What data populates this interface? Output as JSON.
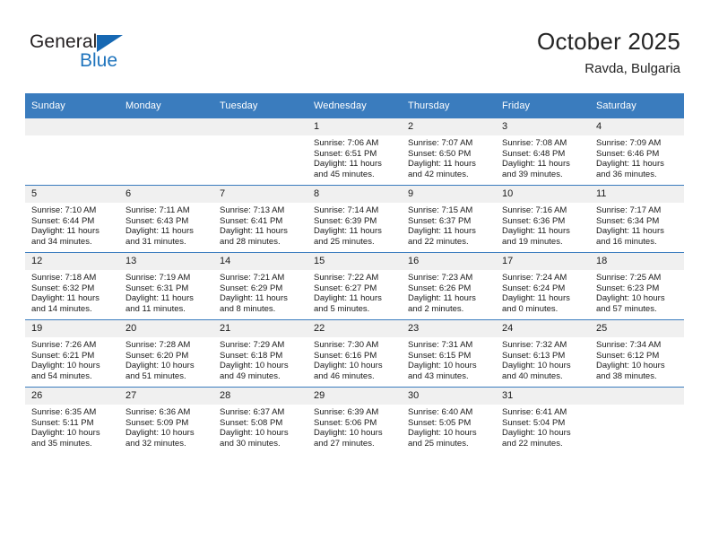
{
  "brand": {
    "name_part1": "General",
    "name_part2": "Blue",
    "logo_icon": "triangle-icon",
    "accent_color": "#1668b3"
  },
  "header": {
    "month_title": "October 2025",
    "location": "Ravda, Bulgaria",
    "header_bg_color": "#3a7cbe",
    "daynum_bg_color": "#f0f0f0"
  },
  "calendar": {
    "weekday_headers": [
      "Sunday",
      "Monday",
      "Tuesday",
      "Wednesday",
      "Thursday",
      "Friday",
      "Saturday"
    ],
    "weeks": [
      [
        {
          "day": "",
          "empty": true,
          "sunrise": "",
          "sunset": "",
          "daylight_line1": "",
          "daylight_line2": ""
        },
        {
          "day": "",
          "empty": true,
          "sunrise": "",
          "sunset": "",
          "daylight_line1": "",
          "daylight_line2": ""
        },
        {
          "day": "",
          "empty": true,
          "sunrise": "",
          "sunset": "",
          "daylight_line1": "",
          "daylight_line2": ""
        },
        {
          "day": "1",
          "empty": false,
          "sunrise": "Sunrise: 7:06 AM",
          "sunset": "Sunset: 6:51 PM",
          "daylight_line1": "Daylight: 11 hours",
          "daylight_line2": "and 45 minutes."
        },
        {
          "day": "2",
          "empty": false,
          "sunrise": "Sunrise: 7:07 AM",
          "sunset": "Sunset: 6:50 PM",
          "daylight_line1": "Daylight: 11 hours",
          "daylight_line2": "and 42 minutes."
        },
        {
          "day": "3",
          "empty": false,
          "sunrise": "Sunrise: 7:08 AM",
          "sunset": "Sunset: 6:48 PM",
          "daylight_line1": "Daylight: 11 hours",
          "daylight_line2": "and 39 minutes."
        },
        {
          "day": "4",
          "empty": false,
          "sunrise": "Sunrise: 7:09 AM",
          "sunset": "Sunset: 6:46 PM",
          "daylight_line1": "Daylight: 11 hours",
          "daylight_line2": "and 36 minutes."
        }
      ],
      [
        {
          "day": "5",
          "empty": false,
          "sunrise": "Sunrise: 7:10 AM",
          "sunset": "Sunset: 6:44 PM",
          "daylight_line1": "Daylight: 11 hours",
          "daylight_line2": "and 34 minutes."
        },
        {
          "day": "6",
          "empty": false,
          "sunrise": "Sunrise: 7:11 AM",
          "sunset": "Sunset: 6:43 PM",
          "daylight_line1": "Daylight: 11 hours",
          "daylight_line2": "and 31 minutes."
        },
        {
          "day": "7",
          "empty": false,
          "sunrise": "Sunrise: 7:13 AM",
          "sunset": "Sunset: 6:41 PM",
          "daylight_line1": "Daylight: 11 hours",
          "daylight_line2": "and 28 minutes."
        },
        {
          "day": "8",
          "empty": false,
          "sunrise": "Sunrise: 7:14 AM",
          "sunset": "Sunset: 6:39 PM",
          "daylight_line1": "Daylight: 11 hours",
          "daylight_line2": "and 25 minutes."
        },
        {
          "day": "9",
          "empty": false,
          "sunrise": "Sunrise: 7:15 AM",
          "sunset": "Sunset: 6:37 PM",
          "daylight_line1": "Daylight: 11 hours",
          "daylight_line2": "and 22 minutes."
        },
        {
          "day": "10",
          "empty": false,
          "sunrise": "Sunrise: 7:16 AM",
          "sunset": "Sunset: 6:36 PM",
          "daylight_line1": "Daylight: 11 hours",
          "daylight_line2": "and 19 minutes."
        },
        {
          "day": "11",
          "empty": false,
          "sunrise": "Sunrise: 7:17 AM",
          "sunset": "Sunset: 6:34 PM",
          "daylight_line1": "Daylight: 11 hours",
          "daylight_line2": "and 16 minutes."
        }
      ],
      [
        {
          "day": "12",
          "empty": false,
          "sunrise": "Sunrise: 7:18 AM",
          "sunset": "Sunset: 6:32 PM",
          "daylight_line1": "Daylight: 11 hours",
          "daylight_line2": "and 14 minutes."
        },
        {
          "day": "13",
          "empty": false,
          "sunrise": "Sunrise: 7:19 AM",
          "sunset": "Sunset: 6:31 PM",
          "daylight_line1": "Daylight: 11 hours",
          "daylight_line2": "and 11 minutes."
        },
        {
          "day": "14",
          "empty": false,
          "sunrise": "Sunrise: 7:21 AM",
          "sunset": "Sunset: 6:29 PM",
          "daylight_line1": "Daylight: 11 hours",
          "daylight_line2": "and 8 minutes."
        },
        {
          "day": "15",
          "empty": false,
          "sunrise": "Sunrise: 7:22 AM",
          "sunset": "Sunset: 6:27 PM",
          "daylight_line1": "Daylight: 11 hours",
          "daylight_line2": "and 5 minutes."
        },
        {
          "day": "16",
          "empty": false,
          "sunrise": "Sunrise: 7:23 AM",
          "sunset": "Sunset: 6:26 PM",
          "daylight_line1": "Daylight: 11 hours",
          "daylight_line2": "and 2 minutes."
        },
        {
          "day": "17",
          "empty": false,
          "sunrise": "Sunrise: 7:24 AM",
          "sunset": "Sunset: 6:24 PM",
          "daylight_line1": "Daylight: 11 hours",
          "daylight_line2": "and 0 minutes."
        },
        {
          "day": "18",
          "empty": false,
          "sunrise": "Sunrise: 7:25 AM",
          "sunset": "Sunset: 6:23 PM",
          "daylight_line1": "Daylight: 10 hours",
          "daylight_line2": "and 57 minutes."
        }
      ],
      [
        {
          "day": "19",
          "empty": false,
          "sunrise": "Sunrise: 7:26 AM",
          "sunset": "Sunset: 6:21 PM",
          "daylight_line1": "Daylight: 10 hours",
          "daylight_line2": "and 54 minutes."
        },
        {
          "day": "20",
          "empty": false,
          "sunrise": "Sunrise: 7:28 AM",
          "sunset": "Sunset: 6:20 PM",
          "daylight_line1": "Daylight: 10 hours",
          "daylight_line2": "and 51 minutes."
        },
        {
          "day": "21",
          "empty": false,
          "sunrise": "Sunrise: 7:29 AM",
          "sunset": "Sunset: 6:18 PM",
          "daylight_line1": "Daylight: 10 hours",
          "daylight_line2": "and 49 minutes."
        },
        {
          "day": "22",
          "empty": false,
          "sunrise": "Sunrise: 7:30 AM",
          "sunset": "Sunset: 6:16 PM",
          "daylight_line1": "Daylight: 10 hours",
          "daylight_line2": "and 46 minutes."
        },
        {
          "day": "23",
          "empty": false,
          "sunrise": "Sunrise: 7:31 AM",
          "sunset": "Sunset: 6:15 PM",
          "daylight_line1": "Daylight: 10 hours",
          "daylight_line2": "and 43 minutes."
        },
        {
          "day": "24",
          "empty": false,
          "sunrise": "Sunrise: 7:32 AM",
          "sunset": "Sunset: 6:13 PM",
          "daylight_line1": "Daylight: 10 hours",
          "daylight_line2": "and 40 minutes."
        },
        {
          "day": "25",
          "empty": false,
          "sunrise": "Sunrise: 7:34 AM",
          "sunset": "Sunset: 6:12 PM",
          "daylight_line1": "Daylight: 10 hours",
          "daylight_line2": "and 38 minutes."
        }
      ],
      [
        {
          "day": "26",
          "empty": false,
          "sunrise": "Sunrise: 6:35 AM",
          "sunset": "Sunset: 5:11 PM",
          "daylight_line1": "Daylight: 10 hours",
          "daylight_line2": "and 35 minutes."
        },
        {
          "day": "27",
          "empty": false,
          "sunrise": "Sunrise: 6:36 AM",
          "sunset": "Sunset: 5:09 PM",
          "daylight_line1": "Daylight: 10 hours",
          "daylight_line2": "and 32 minutes."
        },
        {
          "day": "28",
          "empty": false,
          "sunrise": "Sunrise: 6:37 AM",
          "sunset": "Sunset: 5:08 PM",
          "daylight_line1": "Daylight: 10 hours",
          "daylight_line2": "and 30 minutes."
        },
        {
          "day": "29",
          "empty": false,
          "sunrise": "Sunrise: 6:39 AM",
          "sunset": "Sunset: 5:06 PM",
          "daylight_line1": "Daylight: 10 hours",
          "daylight_line2": "and 27 minutes."
        },
        {
          "day": "30",
          "empty": false,
          "sunrise": "Sunrise: 6:40 AM",
          "sunset": "Sunset: 5:05 PM",
          "daylight_line1": "Daylight: 10 hours",
          "daylight_line2": "and 25 minutes."
        },
        {
          "day": "31",
          "empty": false,
          "sunrise": "Sunrise: 6:41 AM",
          "sunset": "Sunset: 5:04 PM",
          "daylight_line1": "Daylight: 10 hours",
          "daylight_line2": "and 22 minutes."
        },
        {
          "day": "",
          "empty": true,
          "sunrise": "",
          "sunset": "",
          "daylight_line1": "",
          "daylight_line2": ""
        }
      ]
    ]
  }
}
